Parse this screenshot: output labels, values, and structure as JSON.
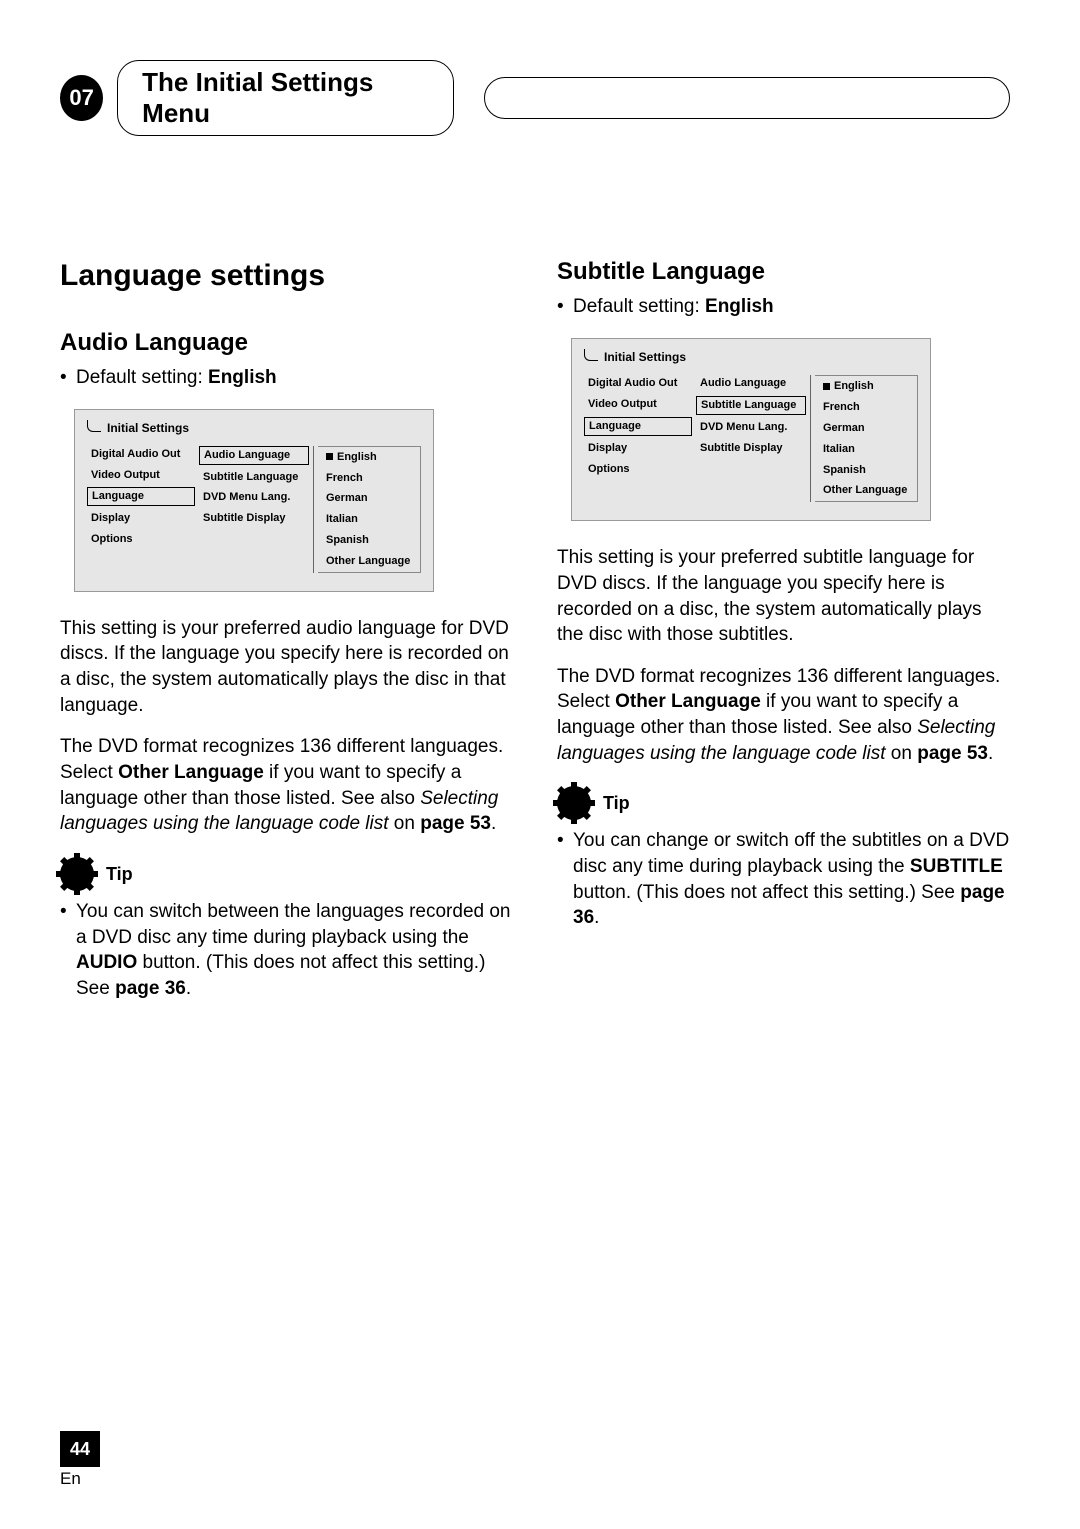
{
  "chapter": {
    "number": "07",
    "title": "The Initial Settings Menu"
  },
  "left": {
    "h1": "Language settings",
    "section": {
      "h2": "Audio Language",
      "default_prefix": "Default setting: ",
      "default_value": "English",
      "settings": {
        "title": "Initial Settings",
        "col1": [
          "Digital Audio Out",
          "Video Output",
          "Language",
          "Display",
          "Options"
        ],
        "col1_selected_index": 2,
        "col2": [
          "Audio Language",
          "Subtitle Language",
          "DVD Menu Lang.",
          "Subtitle Display"
        ],
        "col2_selected_index": 0,
        "col3": [
          "English",
          "French",
          "German",
          "Italian",
          "Spanish",
          "Other Language"
        ],
        "col3_selected_index": 0
      },
      "para1": "This setting is your preferred audio language for DVD discs. If the language you specify here is recorded on a disc, the system automatically plays the disc in that language.",
      "para2a": "The DVD format recognizes 136 different languages. Select ",
      "para2_bold": "Other Language",
      "para2b": " if you want to specify a language other than those listed. See also ",
      "para2_ital": "Selecting languages using the language code list",
      "para2c": " on ",
      "para2_ref": "page 53",
      "para2d": ".",
      "tip_label": "Tip",
      "tip_a": "You can switch between the languages recorded on a DVD disc any time during playback using the ",
      "tip_bold1": "AUDIO",
      "tip_b": " button. (This does not affect this setting.) See ",
      "tip_bold2": "page 36",
      "tip_c": "."
    }
  },
  "right": {
    "section": {
      "h2": "Subtitle Language",
      "default_prefix": "Default setting: ",
      "default_value": "English",
      "settings": {
        "title": "Initial Settings",
        "col1": [
          "Digital Audio Out",
          "Video Output",
          "Language",
          "Display",
          "Options"
        ],
        "col1_selected_index": 2,
        "col2": [
          "Audio Language",
          "Subtitle Language",
          "DVD Menu Lang.",
          "Subtitle Display"
        ],
        "col2_selected_index": 1,
        "col3": [
          "English",
          "French",
          "German",
          "Italian",
          "Spanish",
          "Other Language"
        ],
        "col3_selected_index": 0
      },
      "para1": "This setting is your preferred subtitle language for DVD discs. If the language you specify here is recorded on a disc, the system automatically plays the disc with those subtitles.",
      "para2a": "The DVD format recognizes 136 different languages. Select ",
      "para2_bold": "Other Language",
      "para2b": " if you want to specify a language other than those listed. See also ",
      "para2_ital": "Selecting languages using the language code list",
      "para2c": " on ",
      "para2_ref": "page 53",
      "para2d": ".",
      "tip_label": "Tip",
      "tip_a": "You can change or switch off the subtitles on a DVD disc any time during playback using the ",
      "tip_bold1": "SUBTITLE",
      "tip_b": " button. (This does not affect this setting.) See ",
      "tip_bold2": "page 36",
      "tip_c": "."
    }
  },
  "footer": {
    "page": "44",
    "lang": "En"
  }
}
